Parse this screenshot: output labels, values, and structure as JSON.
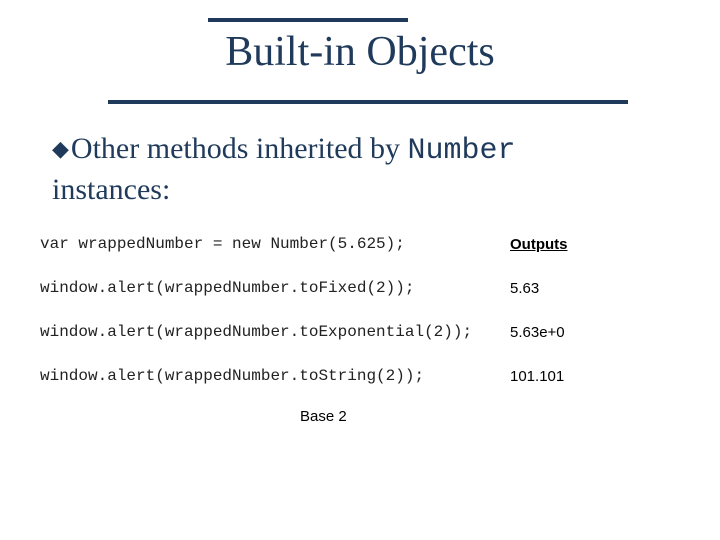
{
  "title": "Built-in Objects",
  "bullet": {
    "pre": "Other methods inherited by ",
    "code": "Number",
    "post": " instances:"
  },
  "outputs_header": "Outputs",
  "rows": [
    {
      "code": "var wrappedNumber = new Number(5.625);",
      "output": ""
    },
    {
      "code": "window.alert(wrappedNumber.toFixed(2));",
      "output": "5.63"
    },
    {
      "code": "window.alert(wrappedNumber.toExponential(2));",
      "output": "5.63e+0"
    },
    {
      "code": "window.alert(wrappedNumber.toString(2));",
      "output": "101.101"
    }
  ],
  "note": "Base 2"
}
